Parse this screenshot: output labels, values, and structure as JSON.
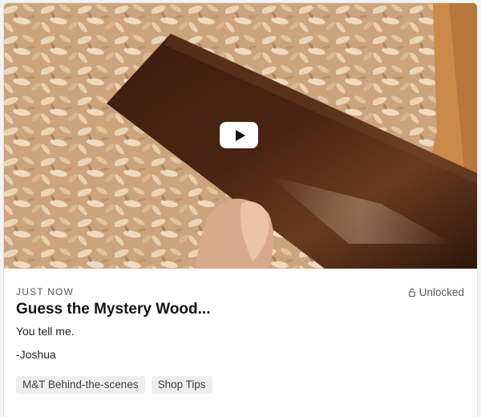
{
  "post": {
    "timestamp": "JUST NOW",
    "access_status": "Unlocked",
    "title": "Guess the Mystery Wood...",
    "body_lines": [
      "You tell me.",
      "-Joshua"
    ],
    "tags": [
      "M&T Behind-the-scenes",
      "Shop Tips"
    ]
  },
  "video": {
    "play_icon": "play-icon",
    "thumbnail_subject": "dark stained wood board held over wood shavings"
  },
  "icons": {
    "lock": "open-lock-icon"
  },
  "colors": {
    "card_background": "#ffffff",
    "page_background": "#f3f3f4",
    "tag_background": "#eeeef0",
    "title_text": "#141414",
    "muted_text": "#55575c"
  }
}
